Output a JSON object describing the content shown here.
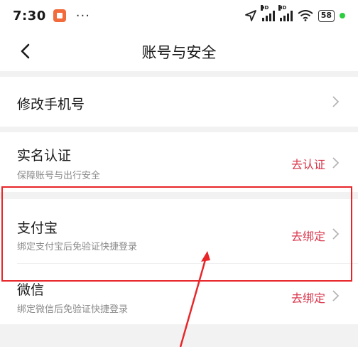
{
  "status_bar": {
    "time": "7:30",
    "more": "···",
    "network_label": "HD",
    "battery": "58"
  },
  "nav": {
    "title": "账号与安全"
  },
  "rows": [
    {
      "title": "修改手机号"
    },
    {
      "title": "实名认证",
      "subtitle": "保障账号与出行安全",
      "action": "去认证"
    },
    {
      "title": "支付宝",
      "subtitle": "绑定支付宝后免验证快捷登录",
      "action": "去绑定"
    },
    {
      "title": "微信",
      "subtitle": "绑定微信后免验证快捷登录",
      "action": "去绑定"
    }
  ],
  "colors": {
    "accent": "#d9344a",
    "annotation": "#e8262a",
    "background": "#f2f2f2"
  }
}
